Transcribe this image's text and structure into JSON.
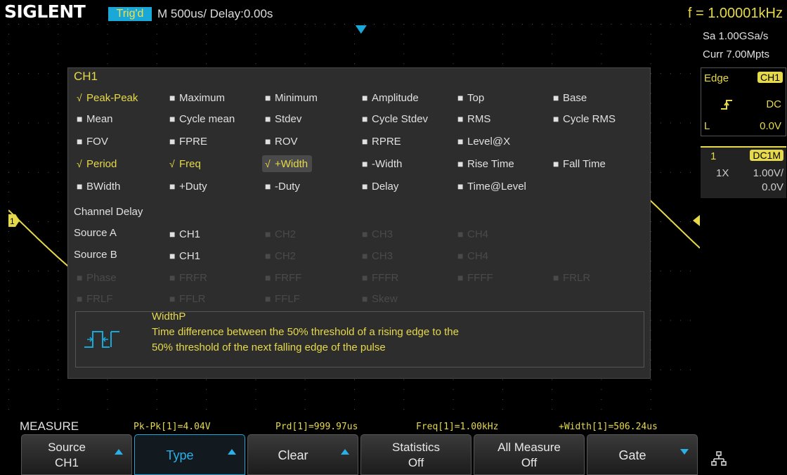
{
  "header": {
    "brand": "SIGLENT",
    "trigger_status": "Trig'd",
    "timebase": "M 500us/   Delay:0.00s",
    "frequency": "f = 1.00001kHz"
  },
  "acquisition": {
    "sample_rate": "Sa 1.00GSa/s",
    "memory_depth": "Curr 7.00Mpts"
  },
  "trigger": {
    "type": "Edge",
    "source": "CH1",
    "coupling": "DC",
    "level_label": "L",
    "level": "0.0V"
  },
  "channel": {
    "number": "1",
    "coupling": "DC1M",
    "probe": "1X",
    "volts_per_div": "1.00V/",
    "offset": "0.0V",
    "marker": "1"
  },
  "dialog": {
    "title": "CH1",
    "rows": [
      [
        {
          "label": "Peak-Peak",
          "state": "on"
        },
        {
          "label": "Maximum",
          "state": "off"
        },
        {
          "label": "Minimum",
          "state": "off"
        },
        {
          "label": "Amplitude",
          "state": "off"
        },
        {
          "label": "Top",
          "state": "off"
        },
        {
          "label": "Base",
          "state": "off"
        }
      ],
      [
        {
          "label": "Mean",
          "state": "off"
        },
        {
          "label": "Cycle mean",
          "state": "off"
        },
        {
          "label": "Stdev",
          "state": "off"
        },
        {
          "label": "Cycle Stdev",
          "state": "off"
        },
        {
          "label": "RMS",
          "state": "off"
        },
        {
          "label": "Cycle RMS",
          "state": "off"
        }
      ],
      [
        {
          "label": "FOV",
          "state": "off"
        },
        {
          "label": "FPRE",
          "state": "off"
        },
        {
          "label": "ROV",
          "state": "off"
        },
        {
          "label": "RPRE",
          "state": "off"
        },
        {
          "label": "Level@X",
          "state": "off"
        }
      ],
      [
        {
          "label": "Period",
          "state": "on"
        },
        {
          "label": "Freq",
          "state": "on"
        },
        {
          "label": "+Width",
          "state": "on",
          "selected": true
        },
        {
          "label": "-Width",
          "state": "off"
        },
        {
          "label": "Rise Time",
          "state": "off"
        },
        {
          "label": "Fall Time",
          "state": "off"
        }
      ],
      [
        {
          "label": "BWidth",
          "state": "off"
        },
        {
          "label": "+Duty",
          "state": "off"
        },
        {
          "label": "-Duty",
          "state": "off"
        },
        {
          "label": "Delay",
          "state": "off"
        },
        {
          "label": "Time@Level",
          "state": "off"
        }
      ]
    ],
    "channel_delay_label": "Channel Delay",
    "source_a_label": "Source A",
    "source_b_label": "Source B",
    "source_a_options": [
      "CH1",
      "CH2",
      "CH3",
      "CH4"
    ],
    "source_b_options": [
      "CH1",
      "CH2",
      "CH3",
      "CH4"
    ],
    "delay_rows": [
      [
        "Phase",
        "FRFR",
        "FRFF",
        "FFFR",
        "FFFF",
        "FRLR"
      ],
      [
        "FRLF",
        "FFLR",
        "FFLF",
        "Skew"
      ]
    ],
    "description": {
      "title": "WidthP",
      "line1": "Time difference between the 50% threshold of a rising edge to the",
      "line2": "50% threshold of the next falling edge of the pulse"
    }
  },
  "measure": {
    "label": "MEASURE",
    "results": [
      "Pk-Pk[1]=4.04V",
      "Prd[1]=999.97us",
      "Freq[1]=1.00kHz",
      "+Width[1]=506.24us"
    ]
  },
  "softkeys": [
    {
      "name": "source",
      "line1": "Source",
      "line2": "CH1",
      "arrow": "up"
    },
    {
      "name": "type",
      "center": "Type",
      "arrow": "up",
      "active": true
    },
    {
      "name": "clear",
      "center": "Clear",
      "arrow": "up"
    },
    {
      "name": "statistics",
      "line1": "Statistics",
      "line2": "Off"
    },
    {
      "name": "all-measure",
      "line1": "All Measure",
      "line2": "Off"
    },
    {
      "name": "gate",
      "center": "Gate",
      "arrow": "down"
    }
  ],
  "colors": {
    "channel1": "#e6d94a",
    "accent": "#1aa8d8"
  },
  "icons": {
    "network": "network-icon",
    "trigger_edge": "rising-edge-icon",
    "pulse": "positive-width-icon"
  }
}
